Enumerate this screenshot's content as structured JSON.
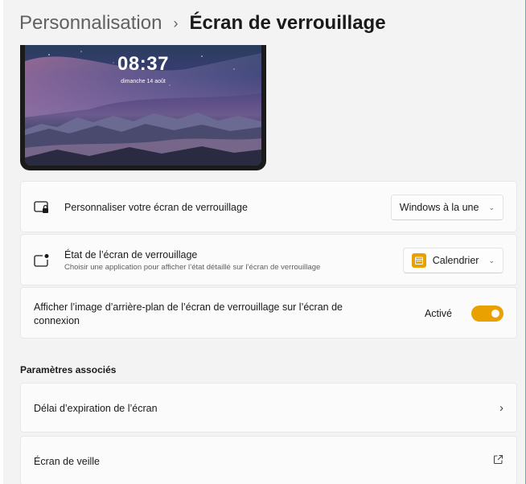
{
  "breadcrumb": {
    "parent": "Personnalisation",
    "separator": "›",
    "current": "Écran de verrouillage"
  },
  "preview": {
    "time": "08:37",
    "date": "dimanche 14 août"
  },
  "settings": {
    "personalize": {
      "icon": "lock-screen-image-icon",
      "title": "Personnaliser votre écran de verrouillage",
      "value": "Windows à la une"
    },
    "status": {
      "icon": "lock-screen-status-icon",
      "title": "État de l’écran de verrouillage",
      "subtitle": "Choisir une application pour afficher l’état détaillé sur l’écran de verrouillage",
      "value": "Calendrier",
      "value_icon": "calendar-icon"
    },
    "signin_background": {
      "title_line1": "Afficher l’image d’arrière-plan de l’écran de verrouillage sur l’écran de",
      "title_line2": "connexion",
      "state_label": "Activé",
      "enabled": true
    }
  },
  "related": {
    "title": "Paramètres associés",
    "items": [
      {
        "label": "Délai d’expiration de l’écran",
        "icon": "chevron-right-icon"
      },
      {
        "label": "Écran de veille",
        "icon": "open-external-icon"
      }
    ]
  },
  "colors": {
    "accent": "#e8a100",
    "window_bg": "#f3f3f3",
    "card_bg": "#fbfbfb"
  }
}
